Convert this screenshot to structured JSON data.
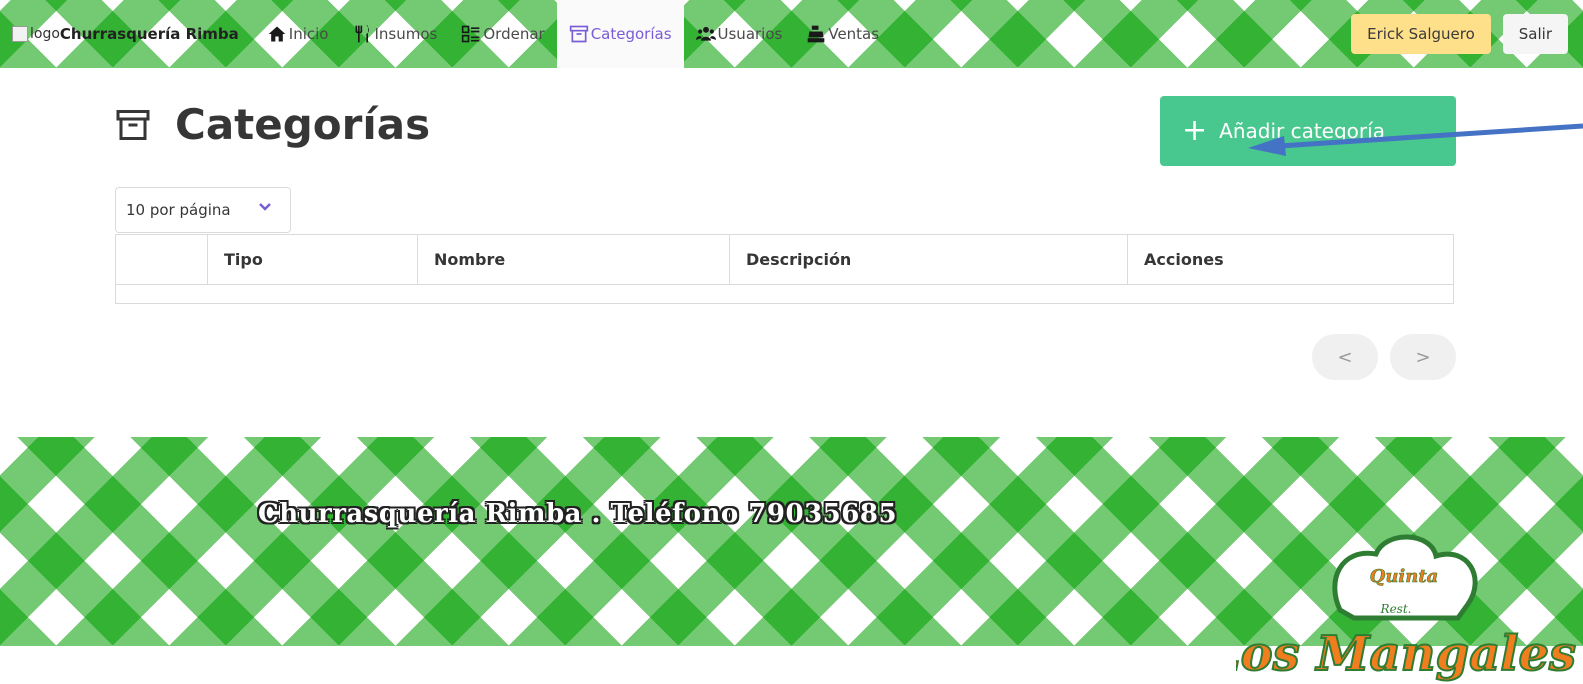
{
  "navbar": {
    "brand_alt": "logo",
    "brand_name": "Churrasquería Rimba",
    "items": [
      {
        "label": "Inicio",
        "icon": "home-icon"
      },
      {
        "label": "Insumos",
        "icon": "utensils-icon"
      },
      {
        "label": "Ordenar",
        "icon": "list-check-icon"
      },
      {
        "label": "Categorías",
        "icon": "archive-icon",
        "active": true
      },
      {
        "label": "Usuarios",
        "icon": "users-icon"
      },
      {
        "label": "Ventas",
        "icon": "cash-register-icon"
      }
    ],
    "user_label": "Erick Salguero",
    "exit_label": "Salir"
  },
  "page": {
    "title": "Categorías",
    "add_button_label": "Añadir categoría"
  },
  "table": {
    "per_page": "10 por página",
    "columns": [
      "",
      "Tipo",
      "Nombre",
      "Descripción",
      "Acciones"
    ],
    "rows": []
  },
  "pager": {
    "prev": "<",
    "next": ">"
  },
  "footer": {
    "text": "Churrasquería Rimba . Teléfono 79035685"
  },
  "logo": {
    "top": "Quinta",
    "mid": "Rest.",
    "bottom": "Los Mangales"
  },
  "colors": {
    "accent_green": "#48c78e",
    "gingham_green": "#009e00",
    "active_purple": "#7a5cd6",
    "warning_yellow": "#ffe08a",
    "arrow_blue": "#4472c4",
    "logo_orange": "#f07d1e",
    "logo_green": "#2e7d32"
  }
}
